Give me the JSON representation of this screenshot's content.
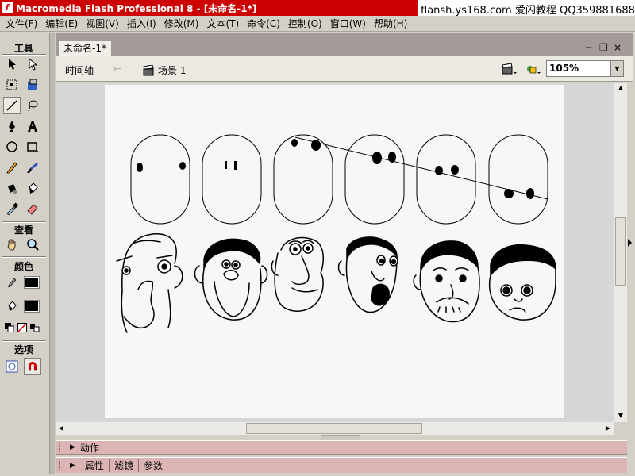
{
  "titlebar": {
    "title": "Macromedia Flash Professional 8 - [未命名-1*]",
    "watermark": "flansh.ys168.com 爱闪教程 QQ359881688"
  },
  "menu": [
    "文件(F)",
    "编辑(E)",
    "视图(V)",
    "插入(I)",
    "修改(M)",
    "文本(T)",
    "命令(C)",
    "控制(O)",
    "窗口(W)",
    "帮助(H)"
  ],
  "tools": {
    "header": "工具",
    "view_header": "查看",
    "colors_header": "颜色",
    "options_header": "选项"
  },
  "document": {
    "tab_label": "未命名-1*",
    "timeline_label": "时间轴",
    "scene_label": "场景 1",
    "zoom": "105%"
  },
  "panels": {
    "actions": "动作",
    "properties_tabs": [
      "属性",
      "滤镜",
      "参数"
    ]
  },
  "colors": {
    "title_red": "#cc0000",
    "panel_pink": "#dcb4b4",
    "stage": "#f7f7f7"
  }
}
